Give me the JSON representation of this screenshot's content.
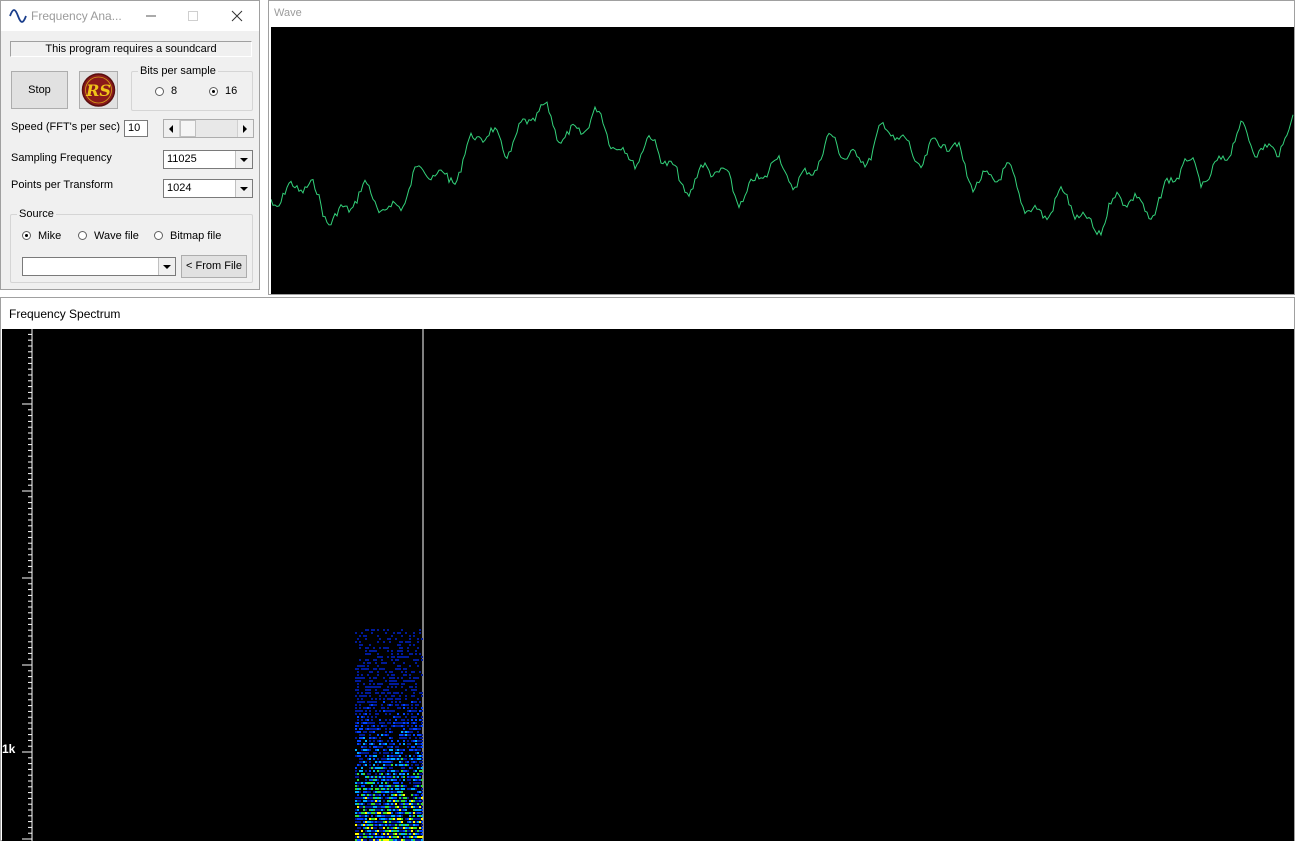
{
  "control_window": {
    "title": "Frequency Ana...",
    "notice": "This program requires a soundcard",
    "stop_label": "Stop",
    "logo_text": "RS",
    "bits_group": {
      "legend": "Bits per sample",
      "options": [
        "8",
        "16"
      ],
      "selected": "16"
    },
    "speed": {
      "label": "Speed (FFT's per sec)",
      "value": "10"
    },
    "sampling": {
      "label": "Sampling Frequency",
      "value": "11025"
    },
    "points": {
      "label": "Points per Transform",
      "value": "1024"
    },
    "source_group": {
      "legend": "Source",
      "options": [
        "Mike",
        "Wave file",
        "Bitmap file"
      ],
      "selected": "Mike",
      "file_value": "",
      "from_file_label": "< From File"
    }
  },
  "wave_window": {
    "title": "Wave",
    "trace_color": "#33d17a"
  },
  "spectrum_window": {
    "title": "Frequency Spectrum",
    "axis_label": "1k"
  },
  "colors": {
    "background": "#000000",
    "wave": "#33d17a"
  }
}
